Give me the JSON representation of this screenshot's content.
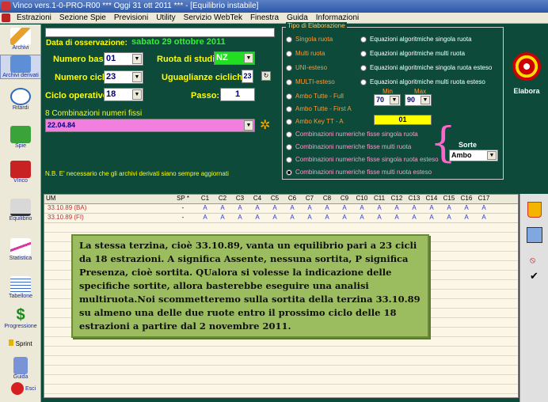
{
  "window": {
    "title": "Vinco vers.1-0-PRO-R00  ***  Oggi 31 ott 2011  ***  - [Equilibrio instabile]"
  },
  "menu": [
    "Estrazioni",
    "Sezione Spie",
    "Previsioni",
    "Utility",
    "Servizio WebTek",
    "Finestra",
    "Guida",
    "Informazioni"
  ],
  "toolbar": [
    {
      "label": "Archivi",
      "icon": "pencil-icon"
    },
    {
      "label": "Archivi derivati",
      "icon": "book-icon"
    },
    {
      "label": "Ritardi",
      "icon": "clock-icon"
    },
    {
      "label": "Spie",
      "icon": "spy-icon"
    },
    {
      "label": "VInco",
      "icon": "vinco-icon"
    },
    {
      "label": "Equilibrio",
      "icon": "scales-icon"
    },
    {
      "label": "Statistica",
      "icon": "chart-icon"
    },
    {
      "label": "Tabellone",
      "icon": "calendar-icon"
    },
    {
      "label": "Progressione",
      "icon": "dollar-icon"
    },
    {
      "label": "Sprint",
      "icon": "sprint-icon"
    },
    {
      "label": "Guida",
      "icon": "guide-icon"
    },
    {
      "label": "Esci",
      "icon": "exit-icon"
    }
  ],
  "form": {
    "date_label": "Data di osservazione:",
    "date_value": "sabato 29 ottobre 2011",
    "base_label": "Numero base:",
    "base_value": "01",
    "cycles_label": "Numero cicli:",
    "cycles_value": "23",
    "cycle_op_label": "Ciclo operativo:",
    "cycle_op_value": "18",
    "wheel_label": "Ruota di studio:",
    "wheel_value": "NZ",
    "equal_label": "Uguaglianze cicliche:",
    "equal_value": "23",
    "step_label": "Passo:",
    "step_value": "1",
    "combo_title": "8 Combinazioni numeri fissi",
    "combo_value": "22.04.84",
    "note": "N.B. E' necessario che gli archivi derivati siano sempre aggiornati"
  },
  "group": {
    "title": "Tipo di Elaborazione",
    "left_options": [
      "Singola ruota",
      "Multi ruota",
      "UNI-esteso",
      "MULTI-esteso",
      "Ambo Tutte - Full",
      "Ambo Tutte - First A",
      "Ambo Key TT -  A"
    ],
    "right_options": [
      "Equazioni algoritmiche singola ruota",
      "Equazioni algoritmiche multi ruota",
      "Equazioni algoritmiche singola ruota esteso",
      "Equazioni algoritmiche multi ruota esteso"
    ],
    "bottom_options": [
      "Combinazioni numeriche fisse singola ruota",
      "Combinazioni numeriche fisse multi ruota",
      "Combinazioni numeriche fisse singola ruota esteso",
      "Combinazioni numeriche fisse multi ruota esteso"
    ],
    "selected_index": 3,
    "min_label": "Min",
    "max_label": "Max",
    "min_value": "70",
    "max_value": "90",
    "key_value": "01",
    "sorte_label": "Sorte",
    "sorte_value": "Ambo"
  },
  "elabora_label": "Elabora",
  "grid": {
    "headers": [
      "UM",
      "SP *",
      "C1",
      "C2",
      "C3",
      "C4",
      "C5",
      "C6",
      "C7",
      "C8",
      "C9",
      "C10",
      "C11",
      "C12",
      "C13",
      "C14",
      "C15",
      "C16",
      "C17"
    ],
    "rows": [
      {
        "label": "33.10.89  (BA)",
        "sp": "-",
        "cells": [
          "A",
          "A",
          "A",
          "A",
          "A",
          "A",
          "A",
          "A",
          "A",
          "A",
          "A",
          "A",
          "A",
          "A",
          "A",
          "A",
          "A"
        ]
      },
      {
        "label": "33.10.89  (FI)",
        "sp": "-",
        "cells": [
          "A",
          "A",
          "A",
          "A",
          "A",
          "A",
          "A",
          "A",
          "A",
          "A",
          "A",
          "A",
          "A",
          "A",
          "A",
          "A",
          "A"
        ]
      }
    ]
  },
  "annotation": "La stessa terzina, cioè 33.10.89, vanta un equilibrio pari a 23 cicli da 18 estrazioni. A significa Assente, nessuna sortita, P significa Presenza, cioè sortita. QUalora si volesse la indicazione delle specifiche sortite, allora basterebbe eseguire una analisi multiruota.Noi scommetteremo sulla sortita della terzina 33.10.89 su almeno una delle due ruote entro il prossimo ciclo delle 18 estrazioni a partire dal 2 novembre 2011."
}
